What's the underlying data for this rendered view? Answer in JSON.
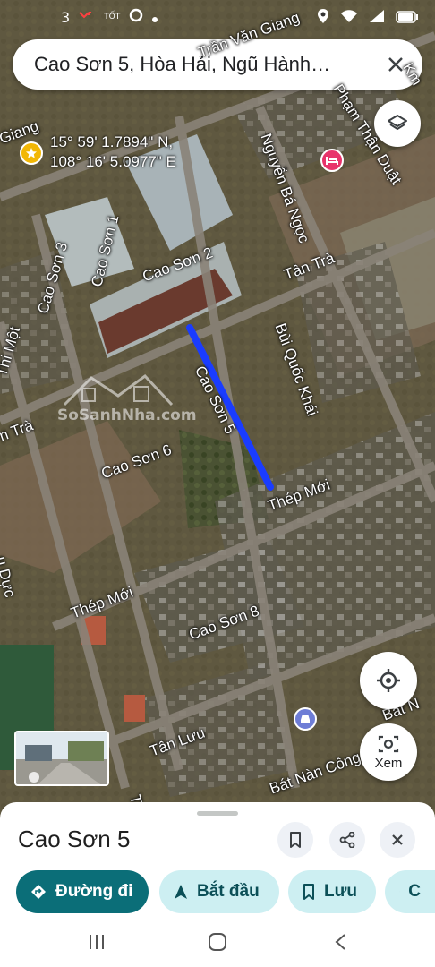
{
  "status_bar": {
    "left_icons": [
      "notification-3-icon",
      "missed-call-icon",
      "carrier-tot-icon",
      "circle-app-icon",
      "dot-icon"
    ],
    "notification_count": "3",
    "carrier": "TỐT",
    "right_icons": [
      "location-icon",
      "wifi-icon",
      "signal-icon",
      "battery-icon"
    ]
  },
  "search": {
    "query": "Cao Sơn 5, Hòa Hải, Ngũ Hành…"
  },
  "coordinates": {
    "lat": "15° 59' 1.7894\" N,",
    "lng": "108° 16' 5.0977\" E"
  },
  "streets": [
    {
      "id": "cao-son-2",
      "name": "Cao Sơn 2"
    },
    {
      "id": "cao-son-1",
      "name": "Cao Sơn 1"
    },
    {
      "id": "cao-son-3",
      "name": "Cao Sơn 3"
    },
    {
      "id": "cao-son-5",
      "name": "Cao Sơn 5"
    },
    {
      "id": "cao-son-6",
      "name": "Cao Sơn 6"
    },
    {
      "id": "cao-son-8",
      "name": "Cao Sơn 8"
    },
    {
      "id": "tan-tra-1",
      "name": "Tân Trà"
    },
    {
      "id": "tan-tra-2",
      "name": "n Trà"
    },
    {
      "id": "bui-quoc-khai",
      "name": "Bùi Quốc Khái"
    },
    {
      "id": "nguyen-ba-ngoc",
      "name": "Nguyễn Bá Ngọc"
    },
    {
      "id": "pham-than-duat",
      "name": "Phạm Thận Duật"
    },
    {
      "id": "tran-van-giang",
      "name": "Trần Văn Giang"
    },
    {
      "id": "thep-moi-1",
      "name": "Thép Mới"
    },
    {
      "id": "thep-moi-2",
      "name": "Thép Mới"
    },
    {
      "id": "tan-luu",
      "name": "Tân Lưu"
    },
    {
      "id": "bat-nan",
      "name": "Bát Nàn Công Chúa"
    },
    {
      "id": "bat-n",
      "name": "Bát N"
    },
    {
      "id": "thi-mot",
      "name": "Thi Một"
    },
    {
      "id": "giang",
      "name": "Giang"
    },
    {
      "id": "duc",
      "name": "u Dực"
    },
    {
      "id": "km",
      "name": "Km"
    },
    {
      "id": "tra",
      "name": "Trầ"
    }
  ],
  "watermark": {
    "text": "SoSanhNha.com"
  },
  "map_buttons": {
    "xem_label": "Xem"
  },
  "place": {
    "title": "Cao Sơn 5",
    "actions": [
      {
        "id": "directions",
        "label": "Đường đi",
        "icon": "directions-icon"
      },
      {
        "id": "start",
        "label": "Bắt đầu",
        "icon": "navigation-arrow-icon"
      },
      {
        "id": "save",
        "label": "Lưu",
        "icon": "bookmark-icon"
      },
      {
        "id": "share",
        "label": "C",
        "icon": "share-icon"
      }
    ]
  },
  "colors": {
    "route": "#1a3cff",
    "primary_chip": "#0b6e78",
    "secondary_chip": "#cdeff2",
    "hotel_pin": "#e8336b",
    "gas_pin": "#6e7dd6",
    "coord_pin": "#f2b705"
  }
}
